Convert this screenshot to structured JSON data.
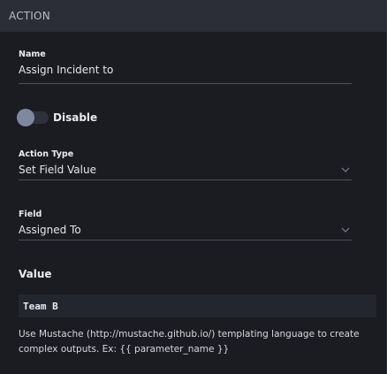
{
  "section": {
    "title": "ACTION"
  },
  "name_field": {
    "label": "Name",
    "value": "Assign Incident to"
  },
  "toggle": {
    "label": "Disable",
    "state": "off"
  },
  "action_type": {
    "label": "Action Type",
    "value": "Set Field Value",
    "icon": "chevron-down-icon"
  },
  "field": {
    "label": "Field",
    "value": "Assigned To",
    "icon": "chevron-down-icon"
  },
  "value_section": {
    "title": "Value",
    "code": "Team B",
    "help": "Use Mustache (http://mustache.github.io/) templating language to create complex outputs. Ex: {{ parameter_name }}"
  },
  "colors": {
    "background": "#1a1c21",
    "header": "#2b2e36",
    "toggle_knob": "#7f889f",
    "code_bg": "#24262d"
  }
}
